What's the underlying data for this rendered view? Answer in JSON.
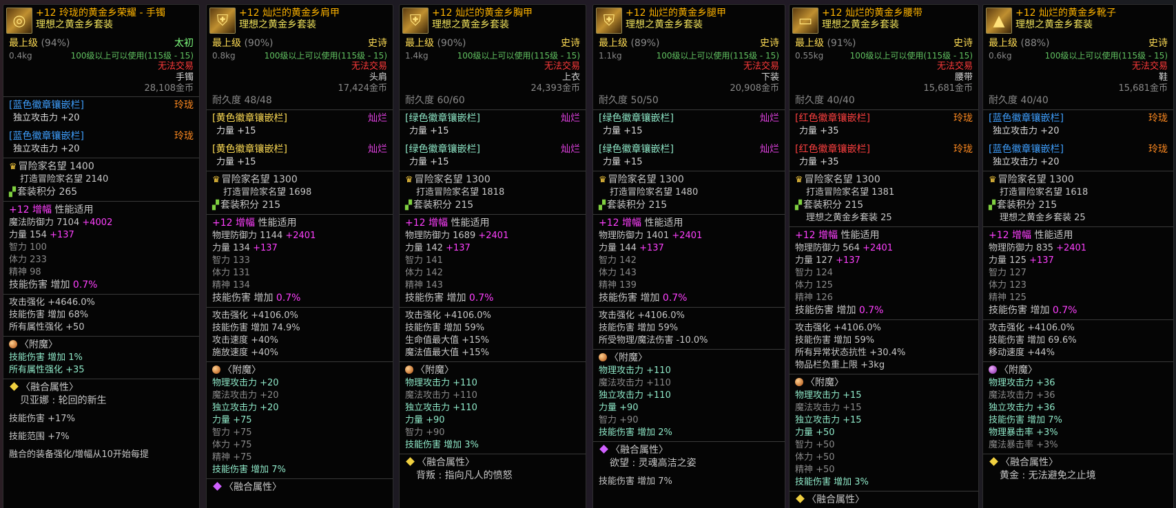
{
  "cards": [
    {
      "title": "+12 玲珑的黄金乡荣耀 - 手镯",
      "set": "理想之黄金乡套装",
      "icon": "bracelet-icon",
      "grade": "最上级",
      "pct": "(94%)",
      "rarity": "太初",
      "weight": "0.4kg",
      "req": "100级以上可以使用(115级 - 15)",
      "trade": "无法交易",
      "slot": "手镯",
      "price": "28,108金币",
      "durability": "",
      "slots": [
        {
          "name": "[蓝色徽章镶嵌栏]",
          "type": "玲珑",
          "stat": "独立攻击力 +20",
          "color": "blue"
        },
        {
          "name": "[蓝色徽章镶嵌栏]",
          "type": "玲珑",
          "stat": "独立攻击力 +20",
          "color": "blue"
        }
      ],
      "fame": "冒险家名望 1400",
      "craft": "打造冒险家名望 2140",
      "setpts": "套装积分 265",
      "setbonus": "",
      "amp": "+12 增幅",
      "ampnote": "性能适用",
      "base": [
        [
          "魔法防御力 7104",
          "+4002"
        ],
        [
          "力量 154",
          "+137"
        ],
        [
          "智力 100",
          ""
        ],
        [
          "体力 233",
          ""
        ],
        [
          "精神 98",
          ""
        ]
      ],
      "skill": "技能伤害 增加",
      "skillv": "0.7%",
      "opts": [
        "攻击强化 +4646.0%",
        "技能伤害 增加 68%",
        "所有属性强化 +50"
      ],
      "ench_icon": "orange",
      "ench": [
        "技能伤害 增加 1%",
        "所有属性强化 +35"
      ],
      "ench_grey": [],
      "fusion_icon": "yellow",
      "fusion": "贝亚娜 : 轮回的新生",
      "fusion_extra": [
        "技能伤害 +17%",
        "技能范围 +7%",
        "融合的装备强化/增幅从10开始每提"
      ]
    },
    {
      "title": "+12 灿烂的黄金乡肩甲",
      "set": "理想之黄金乡套装",
      "icon": "shoulder-armor-icon",
      "grade": "最上级",
      "pct": "(90%)",
      "rarity": "史诗",
      "weight": "0.8kg",
      "req": "100级以上可以使用(115级 - 15)",
      "trade": "无法交易",
      "slot": "头肩",
      "price": "17,424金币",
      "durability": "耐久度 48/48",
      "slots": [
        {
          "name": "[黄色徽章镶嵌栏]",
          "type": "灿烂",
          "stat": "力量 +15",
          "color": "gold"
        },
        {
          "name": "[黄色徽章镶嵌栏]",
          "type": "灿烂",
          "stat": "力量 +15",
          "color": "gold"
        }
      ],
      "fame": "冒险家名望 1300",
      "craft": "打造冒险家名望 1698",
      "setpts": "套装积分 215",
      "setbonus": "",
      "amp": "+12 增幅",
      "ampnote": "性能适用",
      "base": [
        [
          "物理防御力 1144",
          "+2401"
        ],
        [
          "力量 134",
          "+137"
        ],
        [
          "智力 133",
          ""
        ],
        [
          "体力 131",
          ""
        ],
        [
          "精神 134",
          ""
        ]
      ],
      "skill": "技能伤害 增加",
      "skillv": "0.7%",
      "opts": [
        "攻击强化 +4106.0%",
        "技能伤害 增加 74.9%",
        "攻击速度 +40%",
        "施放速度 +40%"
      ],
      "ench_icon": "orange",
      "ench": [
        "物理攻击力 +20",
        "魔法攻击力 +20",
        "独立攻击力 +20",
        "力量 +75",
        "智力 +75",
        "体力 +75",
        "精神 +75",
        "技能伤害 增加 7%"
      ],
      "ench_grey": [
        1,
        4,
        5,
        6
      ],
      "fusion_icon": "purple",
      "fusion": "",
      "fusion_extra": []
    },
    {
      "title": "+12 灿烂的黄金乡胸甲",
      "set": "理想之黄金乡套装",
      "icon": "chest-armor-icon",
      "grade": "最上级",
      "pct": "(90%)",
      "rarity": "史诗",
      "weight": "1.4kg",
      "req": "100级以上可以使用(115级 - 15)",
      "trade": "无法交易",
      "slot": "上衣",
      "price": "24,393金币",
      "durability": "耐久度 60/60",
      "slots": [
        {
          "name": "[绿色徽章镶嵌栏]",
          "type": "灿烂",
          "stat": "力量 +15",
          "color": "green"
        },
        {
          "name": "[绿色徽章镶嵌栏]",
          "type": "灿烂",
          "stat": "力量 +15",
          "color": "green"
        }
      ],
      "fame": "冒险家名望 1300",
      "craft": "打造冒险家名望 1818",
      "setpts": "套装积分 215",
      "setbonus": "",
      "amp": "+12 增幅",
      "ampnote": "性能适用",
      "base": [
        [
          "物理防御力 1689",
          "+2401"
        ],
        [
          "力量 142",
          "+137"
        ],
        [
          "智力 141",
          ""
        ],
        [
          "体力 142",
          ""
        ],
        [
          "精神 143",
          ""
        ]
      ],
      "skill": "技能伤害 增加",
      "skillv": "0.7%",
      "opts": [
        "攻击强化 +4106.0%",
        "技能伤害 增加 59%",
        "生命值最大值 +15%",
        "魔法值最大值 +15%"
      ],
      "ench_icon": "orange",
      "ench": [
        "物理攻击力 +110",
        "魔法攻击力 +110",
        "独立攻击力 +110",
        "力量 +90",
        "智力 +90",
        "技能伤害 增加 3%"
      ],
      "ench_grey": [
        1,
        4
      ],
      "fusion_icon": "yellow",
      "fusion": "背叛 : 指向凡人的愤怒",
      "fusion_extra": []
    },
    {
      "title": "+12 灿烂的黄金乡腿甲",
      "set": "理想之黄金乡套装",
      "icon": "leg-armor-icon",
      "grade": "最上级",
      "pct": "(89%)",
      "rarity": "史诗",
      "weight": "1.1kg",
      "req": "100级以上可以使用(115级 - 15)",
      "trade": "无法交易",
      "slot": "下装",
      "price": "20,908金币",
      "durability": "耐久度 50/50",
      "slots": [
        {
          "name": "[绿色徽章镶嵌栏]",
          "type": "灿烂",
          "stat": "力量 +15",
          "color": "green"
        },
        {
          "name": "[绿色徽章镶嵌栏]",
          "type": "灿烂",
          "stat": "力量 +15",
          "color": "green"
        }
      ],
      "fame": "冒险家名望 1300",
      "craft": "打造冒险家名望 1480",
      "setpts": "套装积分 215",
      "setbonus": "",
      "amp": "+12 增幅",
      "ampnote": "性能适用",
      "base": [
        [
          "物理防御力 1401",
          "+2401"
        ],
        [
          "力量 144",
          "+137"
        ],
        [
          "智力 142",
          ""
        ],
        [
          "体力 143",
          ""
        ],
        [
          "精神 139",
          ""
        ]
      ],
      "skill": "技能伤害 增加",
      "skillv": "0.7%",
      "opts": [
        "攻击强化 +4106.0%",
        "技能伤害 增加 59%",
        "所受物理/魔法伤害 -10.0%"
      ],
      "ench_icon": "orange",
      "ench": [
        "物理攻击力 +110",
        "魔法攻击力 +110",
        "独立攻击力 +110",
        "力量 +90",
        "智力 +90",
        "技能伤害 增加 2%"
      ],
      "ench_grey": [
        1,
        4
      ],
      "fusion_icon": "purple",
      "fusion": "欲望 : 灵魂高洁之姿",
      "fusion_extra": [
        "技能伤害 增加 7%"
      ]
    },
    {
      "title": "+12 灿烂的黄金乡腰带",
      "set": "理想之黄金乡套装",
      "icon": "belt-icon",
      "grade": "最上级",
      "pct": "(91%)",
      "rarity": "史诗",
      "weight": "0.55kg",
      "req": "100级以上可以使用(115级 - 15)",
      "trade": "无法交易",
      "slot": "腰带",
      "price": "15,681金币",
      "durability": "耐久度 40/40",
      "slots": [
        {
          "name": "[红色徽章镶嵌栏]",
          "type": "玲珑",
          "stat": "力量 +35",
          "color": "red"
        },
        {
          "name": "[红色徽章镶嵌栏]",
          "type": "玲珑",
          "stat": "力量 +35",
          "color": "red"
        }
      ],
      "fame": "冒险家名望 1300",
      "craft": "打造冒险家名望 1381",
      "setpts": "套装积分 215",
      "setbonus": "理想之黄金乡套装 25",
      "amp": "+12 增幅",
      "ampnote": "性能适用",
      "base": [
        [
          "物理防御力 564",
          "+2401"
        ],
        [
          "力量 127",
          "+137"
        ],
        [
          "智力 124",
          ""
        ],
        [
          "体力 125",
          ""
        ],
        [
          "精神 126",
          ""
        ]
      ],
      "skill": "技能伤害 增加",
      "skillv": "0.7%",
      "opts": [
        "攻击强化 +4106.0%",
        "技能伤害 增加 59%",
        "所有异常状态抗性 +30.4%",
        "物品栏负重上限 +3kg"
      ],
      "ench_icon": "orange",
      "ench": [
        "物理攻击力 +15",
        "魔法攻击力 +15",
        "独立攻击力 +15",
        "力量 +50",
        "智力 +50",
        "体力 +50",
        "精神 +50",
        "技能伤害 增加 3%"
      ],
      "ench_grey": [
        1,
        4,
        5,
        6
      ],
      "fusion_icon": "yellow",
      "fusion": "",
      "fusion_extra": []
    },
    {
      "title": "+12 灿烂的黄金乡靴子",
      "set": "理想之黄金乡套装",
      "icon": "boots-icon",
      "grade": "最上级",
      "pct": "(88%)",
      "rarity": "史诗",
      "weight": "0.6kg",
      "req": "100级以上可以使用(115级 - 15)",
      "trade": "无法交易",
      "slot": "鞋",
      "price": "15,681金币",
      "durability": "耐久度 40/40",
      "slots": [
        {
          "name": "[蓝色徽章镶嵌栏]",
          "type": "玲珑",
          "stat": "独立攻击力 +20",
          "color": "blue"
        },
        {
          "name": "[蓝色徽章镶嵌栏]",
          "type": "玲珑",
          "stat": "独立攻击力 +20",
          "color": "blue"
        }
      ],
      "fame": "冒险家名望 1300",
      "craft": "打造冒险家名望 1618",
      "setpts": "套装积分 215",
      "setbonus": "理想之黄金乡套装 25",
      "amp": "+12 增幅",
      "ampnote": "性能适用",
      "base": [
        [
          "物理防御力 835",
          "+2401"
        ],
        [
          "力量 125",
          "+137"
        ],
        [
          "智力 127",
          ""
        ],
        [
          "体力 123",
          ""
        ],
        [
          "精神 125",
          ""
        ]
      ],
      "skill": "技能伤害 增加",
      "skillv": "0.7%",
      "opts": [
        "攻击强化 +4106.0%",
        "技能伤害 增加 69.6%",
        "移动速度 +44%"
      ],
      "ench_icon": "purple",
      "ench": [
        "物理攻击力 +36",
        "魔法攻击力 +36",
        "独立攻击力 +36",
        "技能伤害 增加 7%",
        "物理暴击率 +3%",
        "魔法暴击率 +3%"
      ],
      "ench_grey": [
        1,
        5
      ],
      "fusion_icon": "yellow",
      "fusion": "黄金 : 无法避免之止境",
      "fusion_extra": []
    }
  ],
  "labels": {
    "enchant": "〈附魔〉",
    "fusion": "〈融合属性〉"
  }
}
